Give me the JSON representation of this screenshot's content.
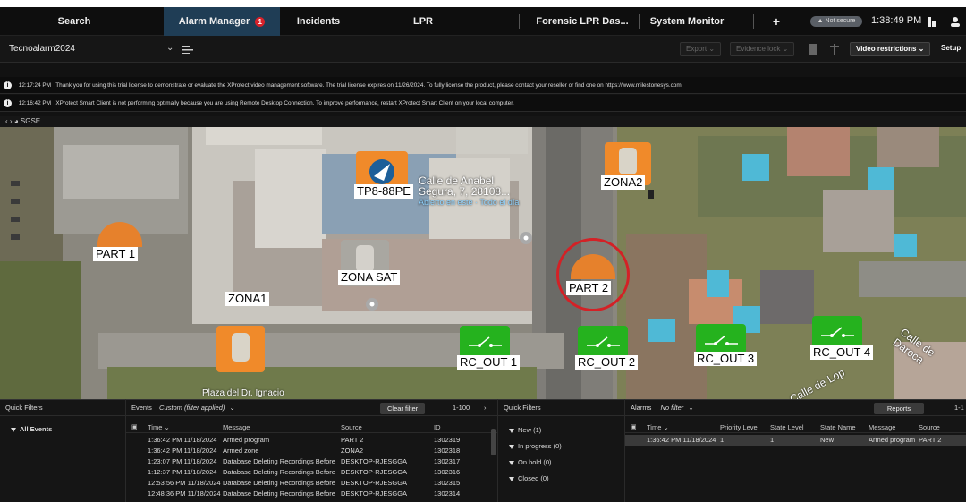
{
  "topbar": {
    "tabs": [
      {
        "label": "Search"
      },
      {
        "label": "Alarm Manager",
        "badge": "1"
      },
      {
        "label": "Incidents"
      },
      {
        "label": "LPR"
      },
      {
        "label": "Forensic LPR Das..."
      },
      {
        "label": "System Monitor"
      }
    ],
    "add_label": "+",
    "not_secure": "Not secure",
    "time": "1:38:49 PM"
  },
  "toolbar": {
    "site": "Tecnoalarm2024",
    "export": "Export",
    "evidence_lock": "Evidence lock",
    "video_restrictions": "Video restrictions",
    "setup": "Setup"
  },
  "messages": [
    {
      "time": "12:17:24 PM",
      "text": "Thank you for using this trial license to demonstrate or evaluate the XProtect video management software. The trial license expires on 11/26/2024. To fully license the product, please contact your reseller or find one on https://www.milestonesys.com."
    },
    {
      "time": "12:16:42 PM",
      "text": "XProtect Smart Client is not performing optimally because you are using Remote Desktop Connection. To improve performance, restart XProtect Smart Client on your local computer."
    }
  ],
  "breadcrumb": "SGSE",
  "map": {
    "labels": {
      "tp8": "TP8-88PE",
      "zona2": "ZONA2",
      "part1": "PART 1",
      "zona_sat": "ZONA SAT",
      "zona1": "ZONA1",
      "part2": "PART 2",
      "rc1": "RC_OUT 1",
      "rc2": "RC_OUT 2",
      "rc3": "RC_OUT 3",
      "rc4": "RC_OUT 4"
    },
    "street_text": [
      "Calle de Anabel",
      "Segura, 7, 28108...",
      "Abierto en este · Todo el día",
      "Calle de Daroca",
      "Calle de Lop"
    ],
    "road_label": "Plaza del Dr. Ignacio"
  },
  "quick_filters_left": {
    "title": "Quick Filters",
    "items": [
      "All Events"
    ]
  },
  "events": {
    "title": "Events",
    "filter": "Custom (filter applied)",
    "clear_label": "Clear filter",
    "range": "1-100",
    "columns": [
      "Time",
      "Message",
      "Source",
      "ID"
    ],
    "rows": [
      [
        "1:36:42 PM 11/18/2024",
        "Armed program",
        "PART 2",
        "1302319"
      ],
      [
        "1:36:42 PM 11/18/2024",
        "Armed zone",
        "ZONA2",
        "1302318"
      ],
      [
        "1:23:07 PM 11/18/2024",
        "Database Deleting Recordings Before",
        "DESKTOP-RJESGGA",
        "1302317"
      ],
      [
        "1:12:37 PM 11/18/2024",
        "Database Deleting Recordings Before",
        "DESKTOP-RJESGGA",
        "1302316"
      ],
      [
        "12:53:56 PM 11/18/2024",
        "Database Deleting Recordings Before",
        "DESKTOP-RJESGGA",
        "1302315"
      ],
      [
        "12:48:36 PM 11/18/2024",
        "Database Deleting Recordings Before",
        "DESKTOP-RJESGGA",
        "1302314"
      ]
    ]
  },
  "quick_filters_mid": {
    "title": "Quick Filters",
    "items": [
      "New (1)",
      "In progress (0)",
      "On hold (0)",
      "Closed (0)"
    ]
  },
  "alarms": {
    "title": "Alarms",
    "filter": "No filter",
    "reports_label": "Reports",
    "range": "1-1",
    "columns": [
      "Time",
      "Priority Level",
      "State Level",
      "State Name",
      "Message",
      "Source"
    ],
    "rows": [
      [
        "1:36:42 PM 11/18/2024",
        "1",
        "1",
        "New",
        "Armed program",
        "PART 2"
      ]
    ]
  },
  "colors": {
    "active_tab": "#1f3d55",
    "alert_red": "#d8222a",
    "marker_orange": "#f08a2a",
    "marker_green": "#25b21e",
    "selected_row": "#3a3a3a"
  }
}
